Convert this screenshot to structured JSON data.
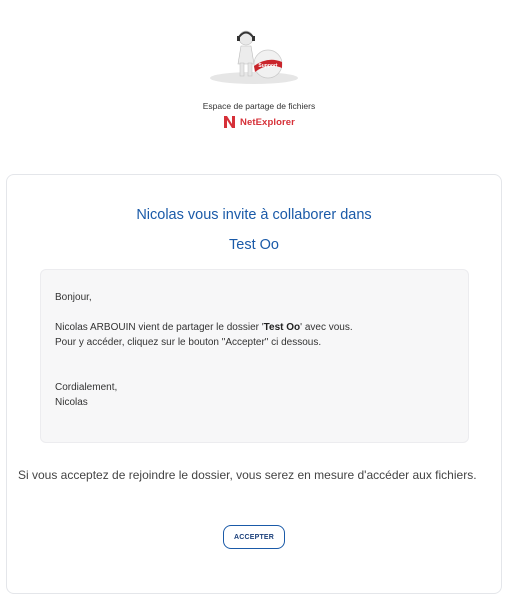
{
  "header": {
    "logo_icon": "support-figure-icon",
    "badge_text": "Support",
    "subtitle": "Espace de partage de fichiers",
    "brand_name": "NetExplorer",
    "brand_color": "#d63038"
  },
  "invite": {
    "title_line1": "Nicolas vous invite à collaborer dans",
    "title_line2": "Test Oo",
    "accent_color": "#1a5aa8"
  },
  "message": {
    "greeting": "Bonjour,",
    "line1_prefix": "Nicolas ARBOUIN vient de partager le dossier '",
    "folder_name": "Test Oo",
    "line1_suffix": "' avec vous.",
    "line2": "Pour y accéder, cliquez sur le bouton \"Accepter\" ci dessous.",
    "signoff": "Cordialement,",
    "signature": "Nicolas"
  },
  "info_text": "Si vous acceptez de rejoindre le dossier, vous serez en mesure d'accéder aux fichiers.",
  "accept_button": "ACCEPTER"
}
